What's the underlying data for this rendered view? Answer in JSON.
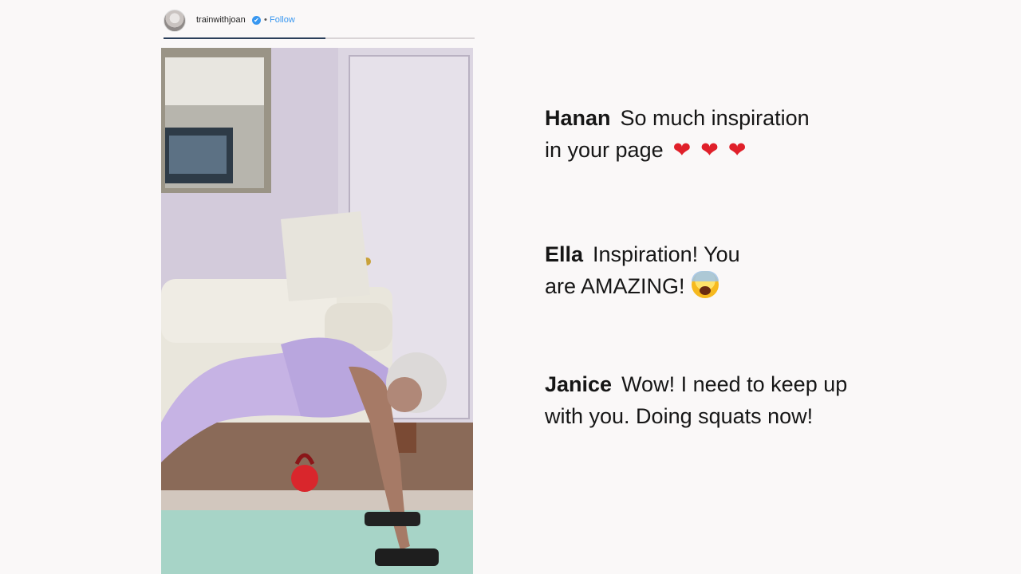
{
  "story": {
    "username": "trainwithjoan",
    "verified_mark": "✔",
    "separator": "•",
    "follow_label": "Follow",
    "progress_fraction": 0.52,
    "accent_color": "#3897f0"
  },
  "video": {
    "scene": "woman doing plank push-up on green mat with dumbbells in living room"
  },
  "comments": [
    {
      "author": "Hanan",
      "line1": "So much inspiration",
      "line2": "in your page",
      "emoji": [
        "heart-icon",
        "heart-icon",
        "heart-icon"
      ]
    },
    {
      "author": "Ella",
      "line1": "Inspiration! You",
      "line2": "are AMAZING!",
      "emoji": [
        "screaming-face-icon"
      ]
    },
    {
      "author": "Janice",
      "line1": "Wow! I need to keep up",
      "line2": "with you. Doing squats now!",
      "emoji": []
    }
  ],
  "colors": {
    "heart": "#e0202a",
    "background": "#faf8f8"
  }
}
